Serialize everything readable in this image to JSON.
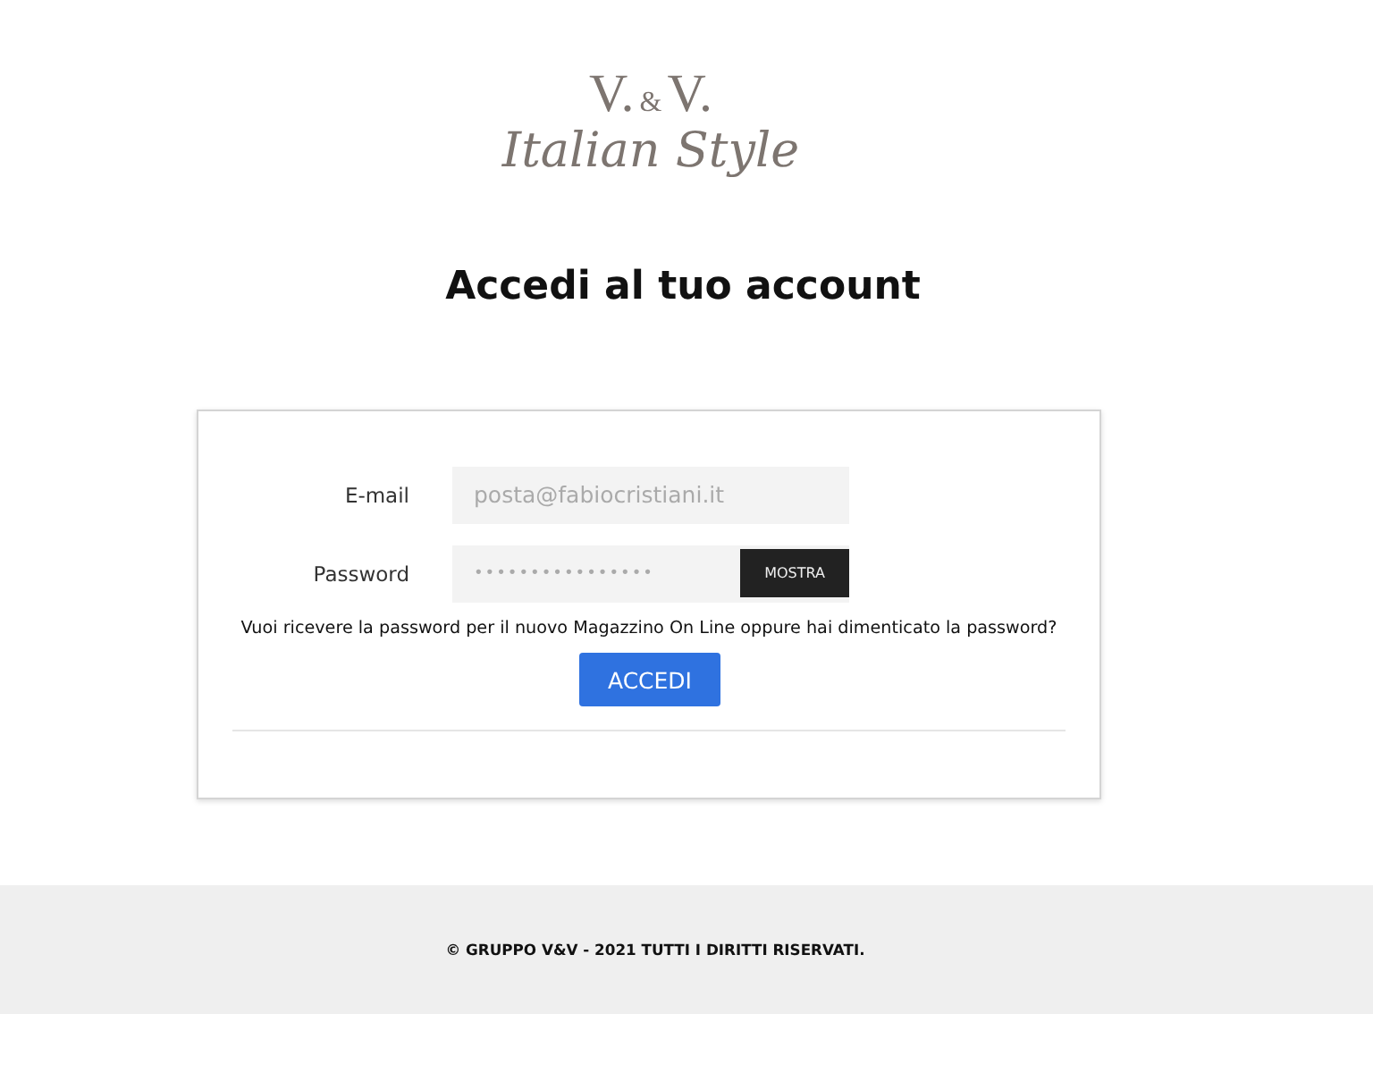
{
  "logo": {
    "initials": [
      "V.",
      "&",
      "V."
    ],
    "tagline": "Italian Style"
  },
  "title": "Accedi al tuo account",
  "form": {
    "email": {
      "label": "E-mail",
      "placeholder": "posta@fabiocristiani.it"
    },
    "password": {
      "label": "Password",
      "value": "••••••••••••••••",
      "toggle": "MOSTRA"
    },
    "help": "Vuoi ricevere la password per il nuovo Magazzino On Line oppure hai dimenticato la password?",
    "submit": "ACCEDI"
  },
  "footer": "© GRUPPO V&V - 2021 TUTTI I DIRITTI RISERVATI."
}
